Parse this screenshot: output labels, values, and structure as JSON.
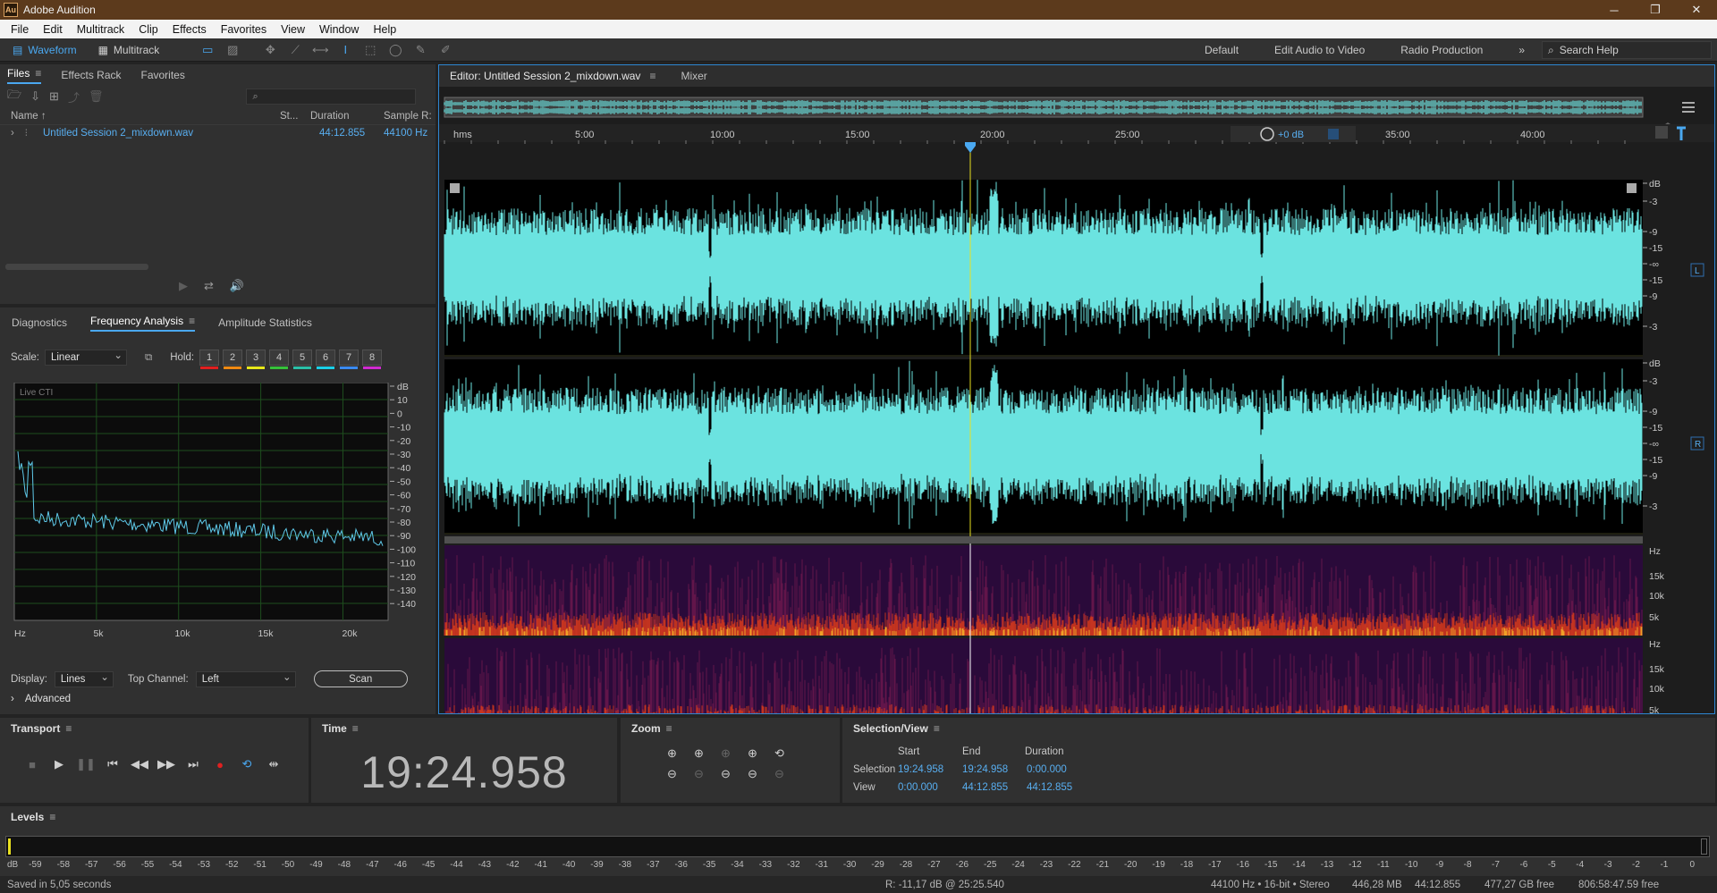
{
  "window": {
    "app_icon": "Au",
    "title": "Adobe Audition",
    "minimize": "─",
    "maximize": "❐",
    "close": "✕"
  },
  "menu": [
    "File",
    "Edit",
    "Multitrack",
    "Clip",
    "Effects",
    "Favorites",
    "View",
    "Window",
    "Help"
  ],
  "toolbar": {
    "waveform_label": "Waveform",
    "multitrack_label": "Multitrack",
    "workspaces": [
      "Default",
      "Edit Audio to Video",
      "Radio Production"
    ],
    "more": "»",
    "search_placeholder": "Search Help"
  },
  "files_panel": {
    "tabs": [
      "Files",
      "Effects Rack",
      "Favorites"
    ],
    "search_placeholder": "",
    "columns": {
      "name": "Name ↑",
      "status": "St...",
      "duration": "Duration",
      "sample_rate": "Sample R:"
    },
    "rows": [
      {
        "name": "Untitled Session 2_mixdown.wav",
        "duration": "44:12.855",
        "sample_rate": "44100 Hz"
      }
    ]
  },
  "analysis_panel": {
    "tabs": [
      "Diagnostics",
      "Frequency Analysis",
      "Amplitude Statistics"
    ],
    "scale_label": "Scale:",
    "scale_value": "Linear",
    "hold_label": "Hold:",
    "hold_buttons": [
      "1",
      "2",
      "3",
      "4",
      "5",
      "6",
      "7",
      "8"
    ],
    "hold_colors": [
      "#e01f1f",
      "#f08a12",
      "#e8e81a",
      "#36c23a",
      "#2ac0a8",
      "#1ad0e8",
      "#3a8af0",
      "#d02ad0"
    ],
    "graph_label": "Live CTI",
    "db_ticks": [
      "dB",
      "10",
      "0",
      "-10",
      "-20",
      "-30",
      "-40",
      "-50",
      "-60",
      "-70",
      "-80",
      "-90",
      "-100",
      "-110",
      "-120",
      "-130",
      "-140"
    ],
    "hz_ticks": [
      "Hz",
      "5k",
      "10k",
      "15k",
      "20k"
    ],
    "display_label": "Display:",
    "display_value": "Lines",
    "top_channel_label": "Top Channel:",
    "top_channel_value": "Left",
    "scan_button": "Scan",
    "advanced_label": "Advanced",
    "curve_color": "#5ec8e8"
  },
  "editor": {
    "tab_label": "Editor: Untitled Session 2_mixdown.wav",
    "mixer_tab": "Mixer",
    "ruler": [
      "hms",
      "5:00",
      "10:00",
      "15:00",
      "20:00",
      "25:00",
      "35:00",
      "40:00"
    ],
    "hud_gain": "+0 dB",
    "waveform_color": "#6be3e0",
    "db_scale_top": [
      "dB",
      "-3",
      "-9",
      "-15",
      "-∞",
      "-15",
      "-9",
      "-3"
    ],
    "db_scale_bottom": [
      "dB",
      "-3",
      "-9",
      "-15",
      "-∞",
      "-15",
      "-9",
      "-3"
    ],
    "channel_left": "L",
    "channel_right": "R",
    "spec_scale": [
      "Hz",
      "15k",
      "10k",
      "5k"
    ]
  },
  "transport": {
    "title": "Transport"
  },
  "time_panel": {
    "title": "Time",
    "value": "19:24.958"
  },
  "zoom_panel": {
    "title": "Zoom"
  },
  "selection_panel": {
    "title": "Selection/View",
    "headers": [
      "Start",
      "End",
      "Duration"
    ],
    "selection_label": "Selection",
    "view_label": "View",
    "selection": [
      "19:24.958",
      "19:24.958",
      "0:00.000"
    ],
    "view": [
      "0:00.000",
      "44:12.855",
      "44:12.855"
    ]
  },
  "levels": {
    "title": "Levels",
    "scale": [
      "dB",
      "-59",
      "-58",
      "-57",
      "-56",
      "-55",
      "-54",
      "-53",
      "-52",
      "-51",
      "-50",
      "-49",
      "-48",
      "-47",
      "-46",
      "-45",
      "-44",
      "-43",
      "-42",
      "-41",
      "-40",
      "-39",
      "-38",
      "-37",
      "-36",
      "-35",
      "-34",
      "-33",
      "-32",
      "-31",
      "-30",
      "-29",
      "-28",
      "-27",
      "-26",
      "-25",
      "-24",
      "-23",
      "-22",
      "-21",
      "-20",
      "-19",
      "-18",
      "-17",
      "-16",
      "-15",
      "-14",
      "-13",
      "-12",
      "-11",
      "-10",
      "-9",
      "-8",
      "-7",
      "-6",
      "-5",
      "-4",
      "-3",
      "-2",
      "-1",
      "0"
    ]
  },
  "status": {
    "saved": "Saved in 5,05 seconds",
    "readout": "R: -11,17 dB @ 25:25.540",
    "format": "44100 Hz • 16-bit • Stereo",
    "size": "446,28 MB",
    "duration": "44:12.855",
    "free": "477,27 GB free",
    "time_free": "806:58:47.59 free"
  }
}
